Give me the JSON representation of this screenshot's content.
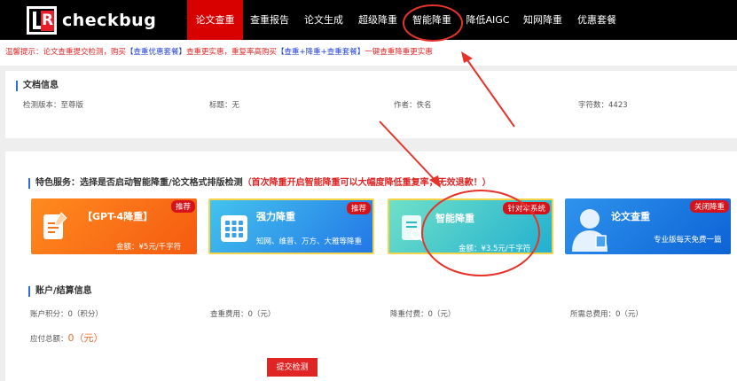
{
  "logo": {
    "mark": "R",
    "text": "checkbug"
  },
  "nav": {
    "items": [
      {
        "label": "论文查重"
      },
      {
        "label": "查重报告"
      },
      {
        "label": "论文生成"
      },
      {
        "label": "超级降重"
      },
      {
        "label": "智能降重"
      },
      {
        "label": "降低AIGC"
      },
      {
        "label": "知网降重"
      },
      {
        "label": "优惠套餐"
      }
    ],
    "active_index": 0
  },
  "notice": {
    "prefix": "温馨提示：论文查重提交检测，购买",
    "link1": "【查重优惠套餐】",
    "mid": "查重更实惠，重复率高购买",
    "link2": "【查重+降重+查重套餐】",
    "suffix": "一键查重降重更实惠"
  },
  "doc_info": {
    "title": "文档信息",
    "version_label": "检测版本：",
    "version_value": "至尊版",
    "title_label": "标题：",
    "title_value": "无",
    "author_label": "作者：",
    "author_value": "佚名",
    "chars_label": "字符数：",
    "chars_value": "4423"
  },
  "features": {
    "title": "特色服务：选择是否启动智能降重/论文格式排版检测",
    "warning": "（首次降重开启智能降重可以大幅度降低重复率，无效退款！）",
    "cards": [
      {
        "title": "【GPT-4降重】",
        "badge": "推荐",
        "price": "金额：¥5元/千字符"
      },
      {
        "title": "强力降重",
        "badge": "推荐",
        "sub": "知网、维普、万方、大雅等降重"
      },
      {
        "title": "智能降重",
        "badge": "针对本系统",
        "price": "金额：¥3.5元/千字符"
      },
      {
        "title": "论文查重",
        "badge": "关闭降重",
        "sub": "专业版每天免费一篇"
      }
    ]
  },
  "account": {
    "title": "账户/结算信息",
    "points_label": "账户积分：",
    "points_value": "0（积分）",
    "check_fee_label": "查重费用：",
    "check_fee_value": "0（元）",
    "reduce_fee_label": "降重付费：",
    "reduce_fee_value": "0（元）",
    "total_fee_label": "所需总费用：",
    "total_fee_value": "0（元）",
    "due_label": "应付总额：",
    "due_value": "0（元）"
  },
  "submit_label": "提交检测",
  "colors": {
    "nav_bg": "#000000",
    "active": "#d90000",
    "accent_red": "#e02424",
    "annotation": "#e63329"
  }
}
